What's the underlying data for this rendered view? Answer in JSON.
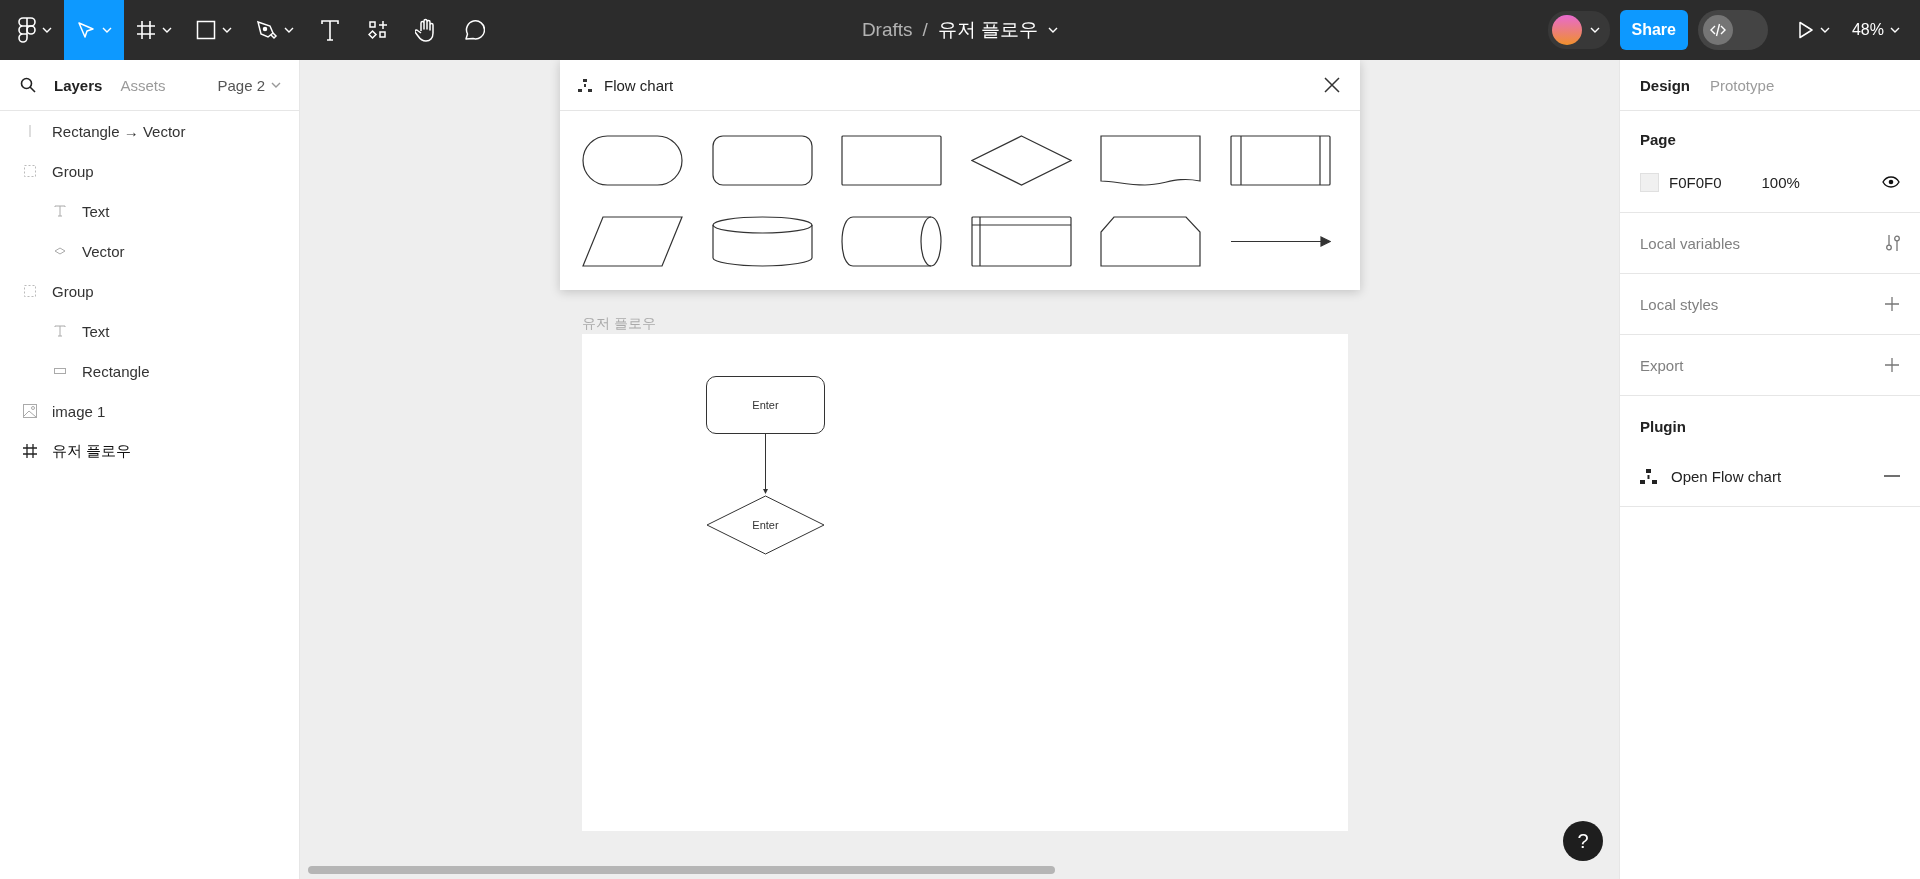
{
  "toolbar": {
    "tools": [
      {
        "kind": "logo",
        "selected": false,
        "dropdown": true
      },
      {
        "kind": "move",
        "selected": true,
        "dropdown": true
      },
      {
        "kind": "frame",
        "selected": false,
        "dropdown": true
      },
      {
        "kind": "shape",
        "selected": false,
        "dropdown": true
      },
      {
        "kind": "pen",
        "selected": false,
        "dropdown": true
      },
      {
        "kind": "text",
        "selected": false,
        "dropdown": false
      },
      {
        "kind": "resources",
        "selected": false,
        "dropdown": false
      },
      {
        "kind": "hand",
        "selected": false,
        "dropdown": false
      },
      {
        "kind": "comment",
        "selected": false,
        "dropdown": false
      }
    ],
    "breadcrumb": {
      "folder": "Drafts",
      "separator": "/",
      "file": "유저 플로우"
    },
    "share_button": "Share",
    "dev_mode": false,
    "zoom": "48%"
  },
  "left_panel": {
    "tabs": [
      {
        "label": "Layers",
        "selected": true
      },
      {
        "label": "Assets",
        "selected": false
      }
    ],
    "page_selector": "Page 2",
    "layers": [
      {
        "kind": "line",
        "name": "Rectangle → Vector"
      },
      {
        "kind": "group",
        "name": "Group",
        "children": [
          {
            "kind": "text",
            "name": "Text"
          },
          {
            "kind": "vector",
            "name": "Vector"
          }
        ]
      },
      {
        "kind": "group",
        "name": "Group",
        "children": [
          {
            "kind": "text",
            "name": "Text"
          },
          {
            "kind": "rectangle",
            "name": "Rectangle"
          }
        ]
      },
      {
        "kind": "image",
        "name": "image 1"
      },
      {
        "kind": "frame",
        "name": "유저 플로우"
      }
    ]
  },
  "plugin_window": {
    "title": "Flow chart",
    "shapes": [
      {
        "kind": "terminal"
      },
      {
        "kind": "rounded"
      },
      {
        "kind": "process"
      },
      {
        "kind": "decision"
      },
      {
        "kind": "document"
      },
      {
        "kind": "predefined"
      },
      {
        "kind": "data"
      },
      {
        "kind": "database"
      },
      {
        "kind": "drum"
      },
      {
        "kind": "storage"
      },
      {
        "kind": "loop"
      },
      {
        "kind": "arrow"
      }
    ]
  },
  "canvas": {
    "help_button": "?",
    "frame_label": "유저 플로우",
    "nodes": [
      {
        "kind": "rounded",
        "text": "Enter"
      },
      {
        "kind": "decision",
        "text": "Enter"
      }
    ]
  },
  "right_panel": {
    "tabs": [
      {
        "label": "Design",
        "selected": true
      },
      {
        "label": "Prototype",
        "selected": false
      }
    ],
    "page": {
      "heading": "Page",
      "color": "F0F0F0",
      "opacity": "100%",
      "visible": true
    },
    "sections": [
      {
        "label": "Local variables",
        "kind": "variables"
      },
      {
        "label": "Local styles",
        "kind": "add"
      },
      {
        "label": "Export",
        "kind": "add"
      }
    ],
    "plugin": {
      "heading": "Plugin",
      "item": "Open Flow chart"
    }
  }
}
